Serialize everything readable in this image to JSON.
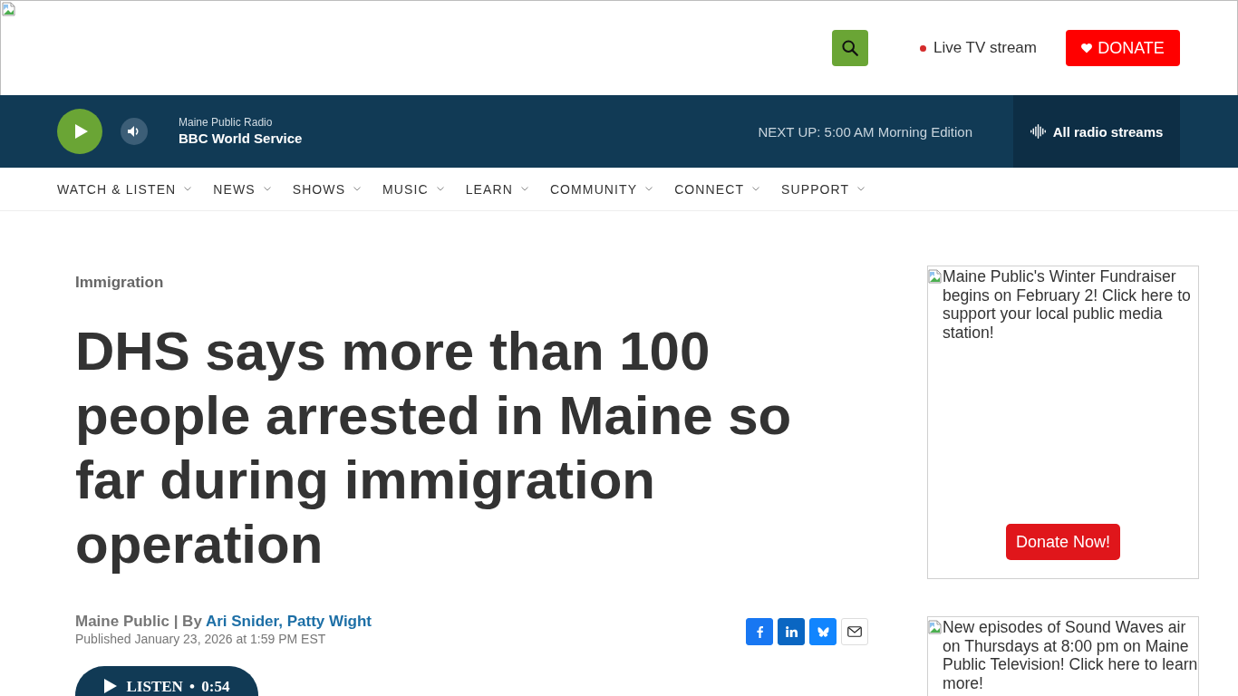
{
  "header": {
    "live_stream_link": "Live TV stream",
    "donate_button": "DONATE"
  },
  "player": {
    "station": "Maine Public Radio",
    "program": "BBC World Service",
    "next_up": "NEXT UP: 5:00 AM Morning Edition",
    "streams_link": "All radio streams"
  },
  "nav": {
    "items": [
      "WATCH & LISTEN",
      "NEWS",
      "SHOWS",
      "MUSIC",
      "LEARN",
      "COMMUNITY",
      "CONNECT",
      "SUPPORT"
    ]
  },
  "article": {
    "category": "Immigration",
    "headline": "DHS says more than 100 people arrested in Maine so far during immigration operation",
    "byline": {
      "source": "Maine Public | By",
      "authors": "Ari Snider, Patty Wight"
    },
    "published": "Published January 23, 2026 at 1:59 PM EST",
    "share_buttons": [
      {
        "kind": "facebook"
      },
      {
        "kind": "linkedin"
      },
      {
        "kind": "bluesky"
      },
      {
        "kind": "email"
      }
    ],
    "listen_button": "LISTEN • 0:54"
  },
  "sidebar": {
    "ads": [
      {
        "alt_text": "Maine Public's Winter Fundraiser begins on February 2! Click here to support your local public media station!",
        "button": "Donate Now!"
      },
      {
        "alt_text": "New episodes of Sound Waves air on Thursdays at 8:00 pm on Maine Public Television! Click here to learn more!"
      }
    ]
  }
}
